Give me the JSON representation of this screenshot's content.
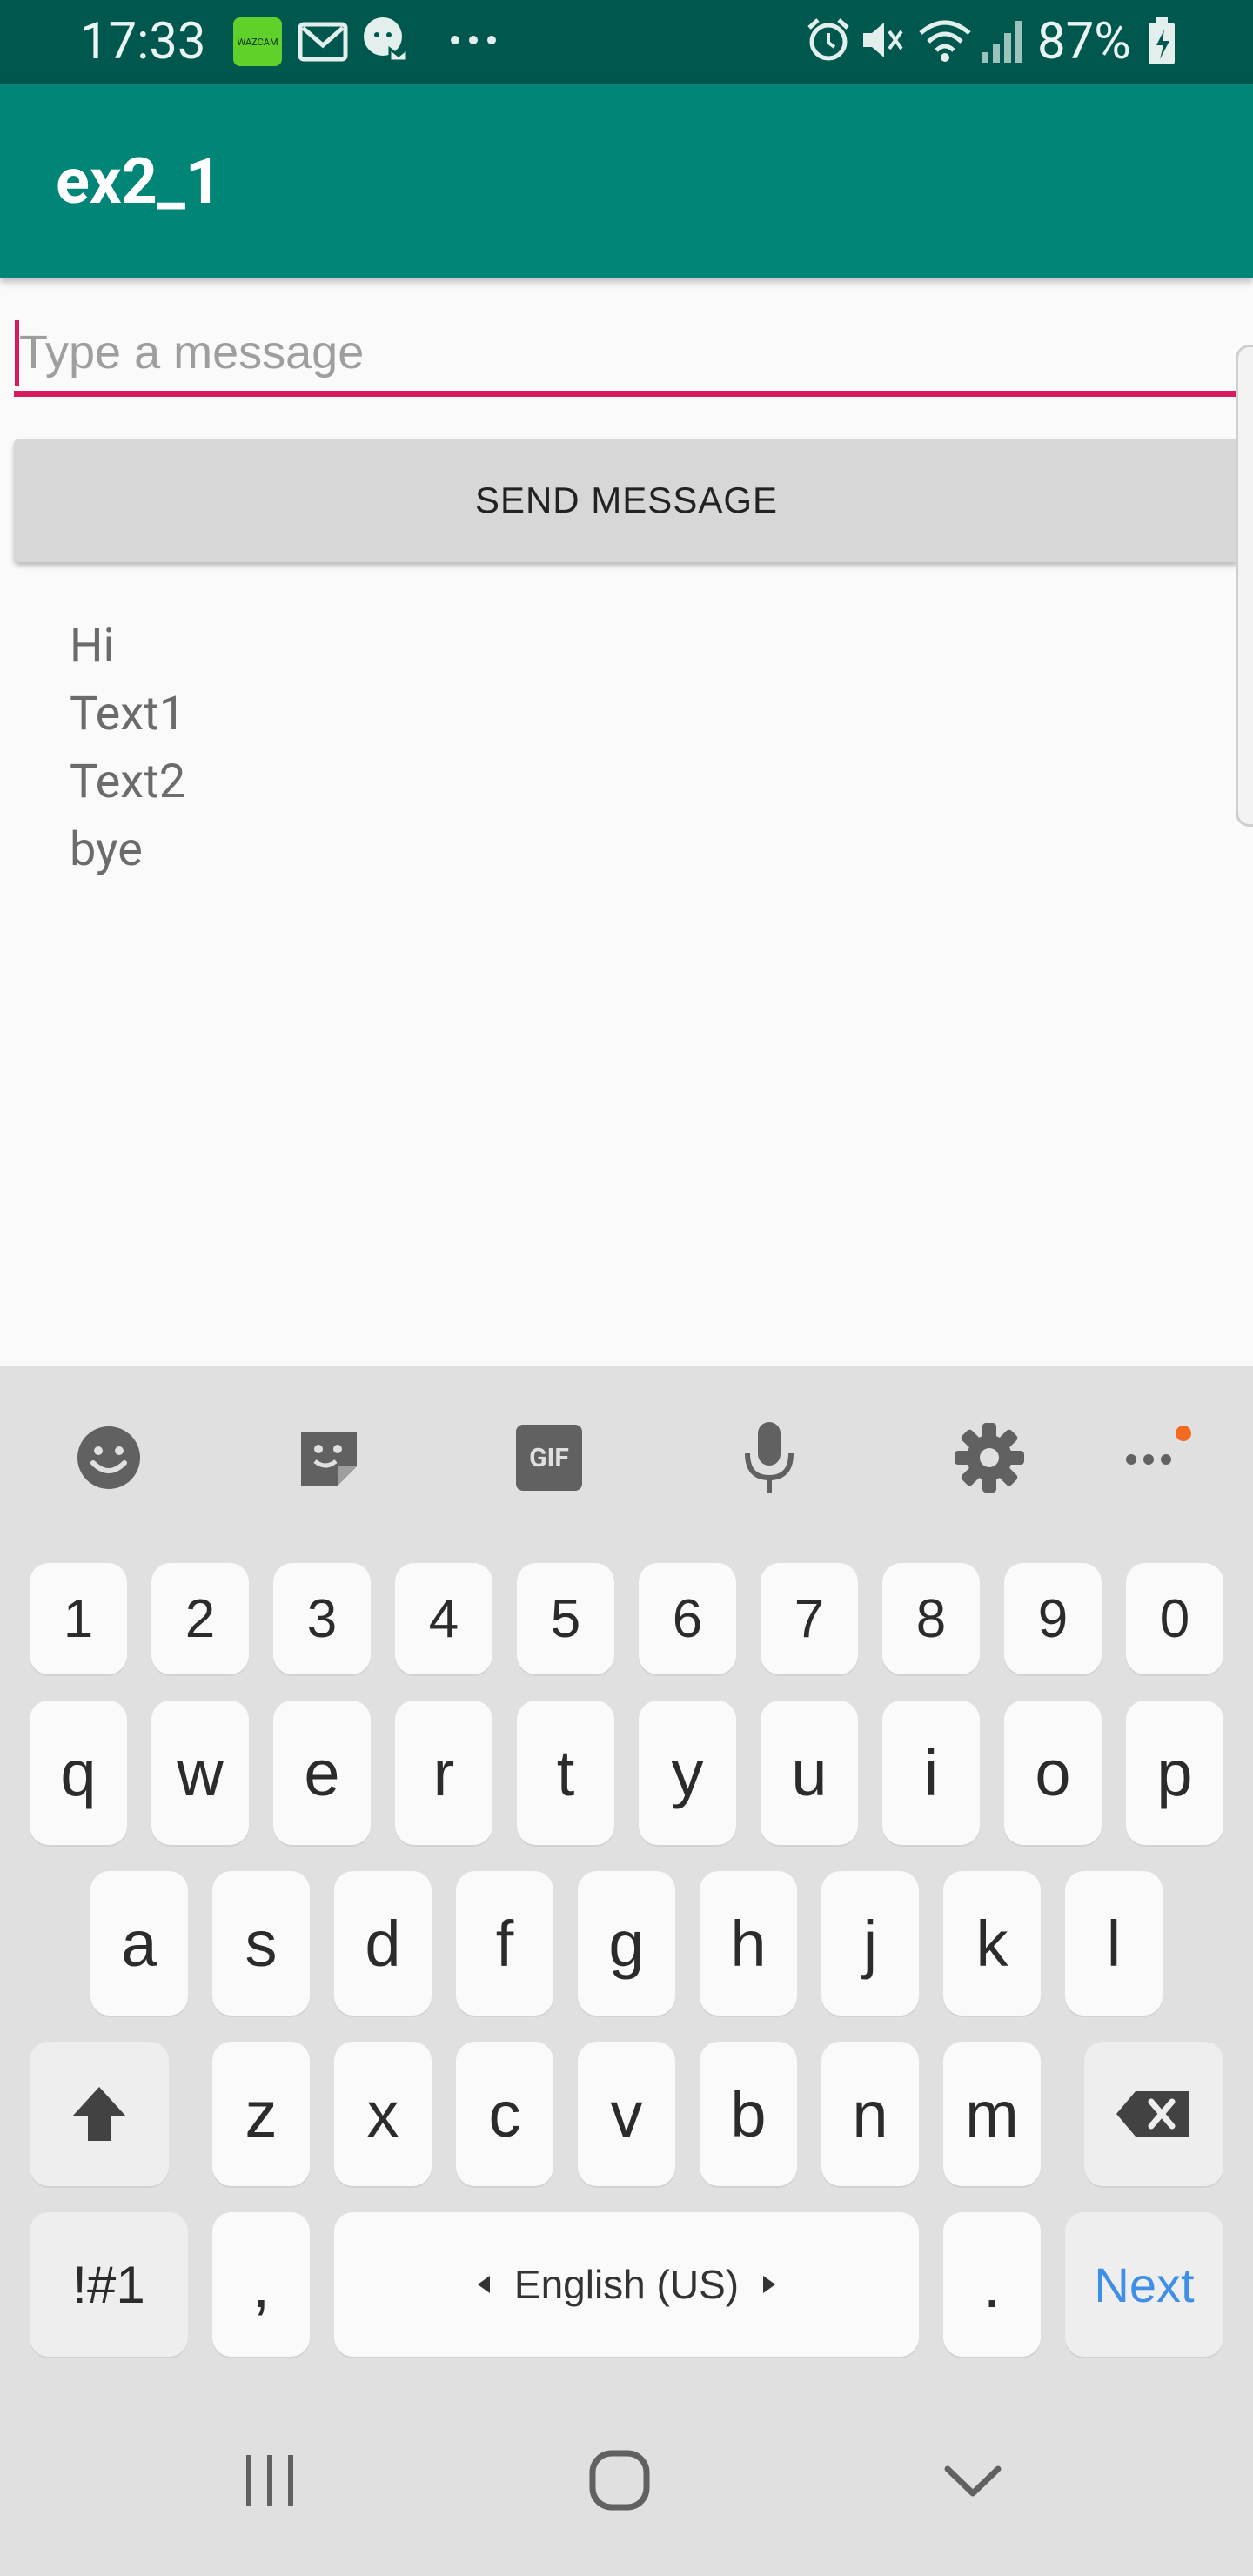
{
  "status_bar": {
    "time": "17:33",
    "battery_percent": "87%",
    "left_icons": [
      "wazcam-app-icon",
      "gmail-icon",
      "messaging-icon",
      "more-dots-icon"
    ],
    "right_icons": [
      "alarm-icon",
      "mute-icon",
      "wifi-icon",
      "signal-icon",
      "battery-charging-icon"
    ],
    "wazcam_label": "WAZCAM"
  },
  "app_bar": {
    "title": "ex2_1",
    "color": "#008577"
  },
  "form": {
    "input_placeholder": "Type a message",
    "send_label": "SEND MESSAGE",
    "accent_color": "#d81b60"
  },
  "messages": [
    "Hi",
    "Text1",
    "Text2",
    "bye"
  ],
  "keyboard": {
    "toolbar": [
      "emoji-icon",
      "sticker-icon",
      "gif-icon",
      "microphone-icon",
      "settings-icon",
      "more-icon"
    ],
    "gif_label": "GIF",
    "row_numbers": [
      "1",
      "2",
      "3",
      "4",
      "5",
      "6",
      "7",
      "8",
      "9",
      "0"
    ],
    "row1": [
      "q",
      "w",
      "e",
      "r",
      "t",
      "y",
      "u",
      "i",
      "o",
      "p"
    ],
    "row2": [
      "a",
      "s",
      "d",
      "f",
      "g",
      "h",
      "j",
      "k",
      "l"
    ],
    "row3": [
      "z",
      "x",
      "c",
      "v",
      "b",
      "n",
      "m"
    ],
    "symbols_label": "!#1",
    "comma_label": ",",
    "space_label": "English (US)",
    "period_label": ".",
    "next_label": "Next"
  },
  "nav_bar": [
    "recent-apps-icon",
    "home-icon",
    "back-icon"
  ]
}
